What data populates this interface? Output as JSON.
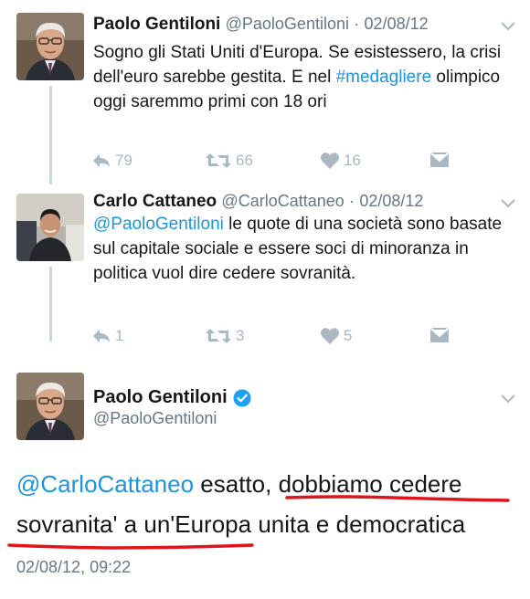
{
  "tweets": [
    {
      "name": "Paolo Gentiloni",
      "handle": "@PaoloGentiloni",
      "separator": "·",
      "date": "02/08/12",
      "text_before": "Sogno gli Stati Uniti d'Europa. Se esistessero, la crisi dell'euro sarebbe gestita. E nel ",
      "hashtag": "#medagliere",
      "text_after": " olimpico oggi saremmo primi con 18 ori",
      "replies": "79",
      "retweets": "66",
      "likes": "16"
    },
    {
      "name": "Carlo Cattaneo",
      "handle": "@CarloCattaneo",
      "separator": "·",
      "date": "02/08/12",
      "mention": "@PaoloGentiloni",
      "text_after": " le quote di una società sono basate sul capitale sociale e essere soci di minoranza in politica vuol dire cedere sovranità.",
      "replies": "1",
      "retweets": "3",
      "likes": "5"
    }
  ],
  "main_tweet": {
    "name": "Paolo Gentiloni",
    "handle": "@PaoloGentiloni",
    "mention": "@CarloCattaneo",
    "text_1": " esatto, ",
    "text_underlined_1": "dobbiamo cedere",
    "text_underlined_2": "sovranita' a un'Europa",
    "text_2": " unita e democratica",
    "timestamp": "02/08/12, 09:22",
    "verified": true
  },
  "colors": {
    "link": "#1b95e0",
    "secondary_text": "#657786",
    "action_icons": "#aab8c2",
    "annotation": "#e0141b",
    "verified_badge": "#1da1f2"
  },
  "icons": [
    "reply-icon",
    "retweet-icon",
    "like-icon",
    "direct-message-icon",
    "chevron-down-icon",
    "verified-badge-icon"
  ]
}
